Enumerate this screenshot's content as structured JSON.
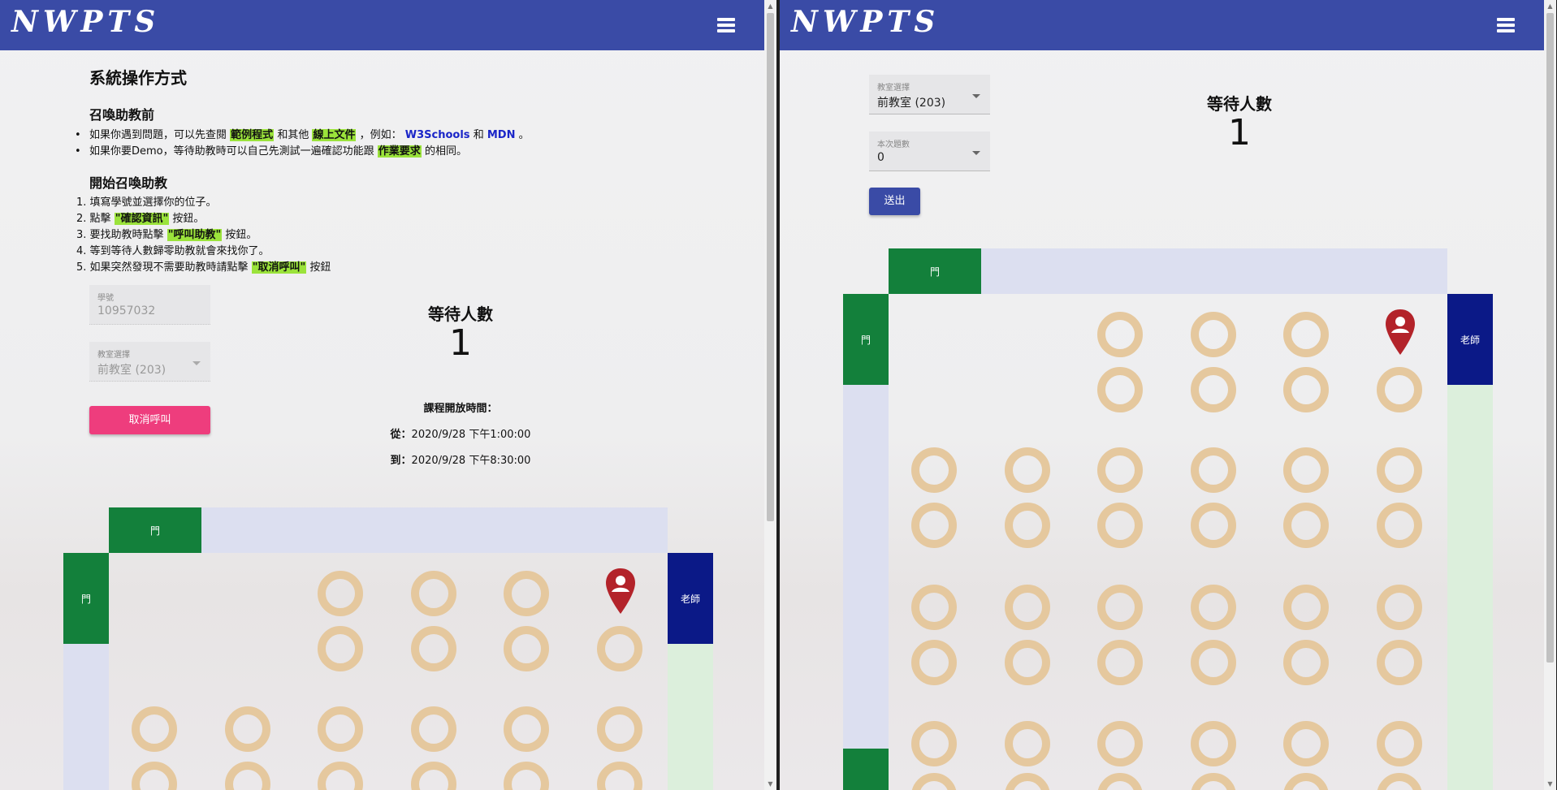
{
  "app": {
    "brand": "NWPTS"
  },
  "left": {
    "instructions": {
      "title": "系統操作方式",
      "before": {
        "heading": "召喚助教前",
        "item1": {
          "a": "如果你遇到問題，可以先查閱",
          "h1": "範例程式",
          "b": "和其他",
          "h2": "線上文件",
          "c": "，例如：",
          "link1": "W3Schools",
          "and": "和",
          "link2": "MDN",
          "end": "。"
        },
        "item2": {
          "a": "如果你要Demo，等待助教時可以自己先測試一遍確認功能跟",
          "h": "作業要求",
          "b": "的相同。"
        }
      },
      "start": {
        "heading": "開始召喚助教",
        "steps": [
          {
            "num": "1.",
            "text": "填寫學號並選擇你的位子。"
          },
          {
            "num": "2.",
            "text": "點擊",
            "hl": "\"確認資訊\"",
            "after": "按鈕。"
          },
          {
            "num": "3.",
            "text": "要找助教時點擊",
            "hl": "\"呼叫助教\"",
            "after": "按鈕。"
          },
          {
            "num": "4.",
            "text": "等到等待人數歸零助教就會來找你了。"
          },
          {
            "num": "5.",
            "text": "如果突然發現不需要助教時請點擊",
            "hl": "\"取消呼叫\"",
            "after": "按鈕"
          }
        ]
      }
    },
    "form": {
      "student_id_label": "學號",
      "student_id_value": "10957032",
      "classroom_label": "教室選擇",
      "classroom_value": "前教室 (203)",
      "cancel_button": "取消呼叫"
    },
    "wait": {
      "title": "等待人數",
      "count": "1"
    },
    "schedule": {
      "title": "課程開放時間：",
      "from_label": "從：",
      "from_value": "2020/9/28 下午1:00:00",
      "to_label": "到：",
      "to_value": "2020/9/28 下午8:30:00"
    },
    "map": {
      "door_label": "門",
      "teacher_label": "老師"
    }
  },
  "right": {
    "form": {
      "classroom_label": "教室選擇",
      "classroom_value": "前教室 (203)",
      "questions_label": "本次題數",
      "questions_value": "0",
      "submit_button": "送出"
    },
    "wait": {
      "title": "等待人數",
      "count": "1"
    },
    "map": {
      "door_label": "門",
      "teacher_label": "老師"
    }
  },
  "colors": {
    "appbar": "#3a4ba6",
    "cancel": "#ee3d7d",
    "door": "#13803b",
    "teacher": "#0b1987",
    "seat": "#e5c89e",
    "pin": "#b3232a"
  }
}
